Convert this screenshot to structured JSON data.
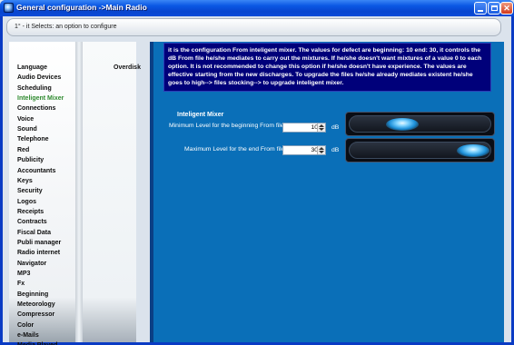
{
  "window": {
    "title": "General configuration ->Main Radio",
    "controls": {
      "minimize": "minimize-icon",
      "maximize": "maximize-icon",
      "close": "close-icon"
    }
  },
  "infobar": {
    "text": "1° - it Selects: an option to configure"
  },
  "sidebar": {
    "items": [
      {
        "label": "Language",
        "active": false
      },
      {
        "label": "Audio Devices",
        "active": false
      },
      {
        "label": "Scheduling",
        "active": false
      },
      {
        "label": "Inteligent Mixer",
        "active": true
      },
      {
        "label": "Connections",
        "active": false
      },
      {
        "label": "Voice",
        "active": false
      },
      {
        "label": "Sound",
        "active": false
      },
      {
        "label": "Telephone",
        "active": false
      },
      {
        "label": "Red",
        "active": false
      },
      {
        "label": "Publicity",
        "active": false
      },
      {
        "label": "Accountants",
        "active": false
      },
      {
        "label": "Keys",
        "active": false
      },
      {
        "label": "Security",
        "active": false
      },
      {
        "label": "Logos",
        "active": false
      },
      {
        "label": "Receipts",
        "active": false
      },
      {
        "label": "Contracts",
        "active": false
      },
      {
        "label": "Fiscal Data",
        "active": false
      },
      {
        "label": "Publi manager",
        "active": false
      },
      {
        "label": "Radio internet",
        "active": false
      },
      {
        "label": "Navigator",
        "active": false
      },
      {
        "label": "MP3",
        "active": false
      },
      {
        "label": "Fx",
        "active": false
      },
      {
        "label": "Beginning",
        "active": false
      },
      {
        "label": "Meteorology",
        "active": false
      },
      {
        "label": "Compressor",
        "active": false
      },
      {
        "label": "Color",
        "active": false
      },
      {
        "label": "e-Mails",
        "active": false
      },
      {
        "label": "Media Played",
        "active": false
      }
    ]
  },
  "options": {
    "items": [
      "Overdisk"
    ]
  },
  "main": {
    "info": "it is the configuration From inteligent mixer. The values for defect are beginning: 10 end: 30, it controls the dB From file he/she mediates to carry out the mixtures. If he/she doesn't want mixtures of a value 0 to each option. It is not recommended to change this option if he/she doesn't have experience. The values are effective starting from the new discharges. To upgrade the files he/she already mediates existent he/she goes to high--> files stocking--> to upgrade inteligent mixer.",
    "section_title": "Inteligent Mixer",
    "rows": [
      {
        "label": "Minimum Level for the beginning From file",
        "value": "10",
        "unit": "dB",
        "level": 0.33
      },
      {
        "label": "Maximum Level for the end From file",
        "value": "30",
        "unit": "dB",
        "level": 1.0
      }
    ]
  },
  "colors": {
    "title_bar": "#0b58e4",
    "content_bg": "#0a6fb8",
    "info_box_bg": "#00007a",
    "active_menu_item": "#2f8a2f"
  }
}
